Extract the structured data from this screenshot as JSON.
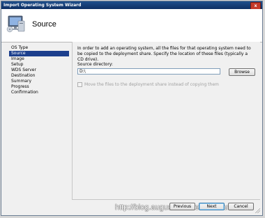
{
  "window": {
    "title": "Import Operating System Wizard",
    "close_symbol": "x"
  },
  "header": {
    "title": "Source",
    "icon": "computer-monitor-icon"
  },
  "nav": {
    "items": [
      {
        "label": "OS Type"
      },
      {
        "label": "Source"
      },
      {
        "label": "Image"
      },
      {
        "label": "Setup"
      },
      {
        "label": "WDS Server"
      },
      {
        "label": "Destination"
      },
      {
        "label": "Summary"
      },
      {
        "label": "Progress"
      },
      {
        "label": "Confirmation"
      }
    ],
    "selected": "Source"
  },
  "content": {
    "description": "In order to add an operating system, all the files for that operating system need to be copied to the deployment share.  Specify the location of these files (typically a CD drive).",
    "source_directory_label": "Source directory:",
    "source_directory_value": "D:\\",
    "browse_label": "Browse",
    "move_files_label": "Move the files to the deployment share instead of copying them"
  },
  "footer": {
    "previous_label": "Previous",
    "next_label": "Next",
    "cancel_label": "Cancel"
  },
  "watermark": "http://blog.augustoalvarez.com.ar/"
}
